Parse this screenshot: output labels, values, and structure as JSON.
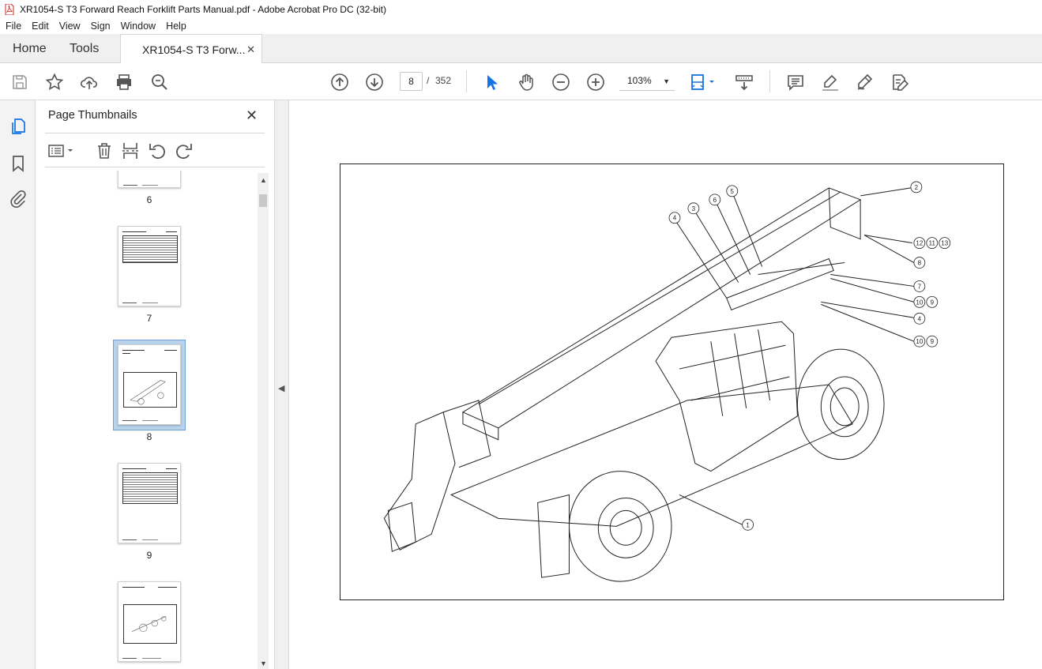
{
  "window": {
    "title": "XR1054-S T3 Forward Reach Forklift Parts Manual.pdf - Adobe Acrobat Pro DC (32-bit)"
  },
  "menu": [
    "File",
    "Edit",
    "View",
    "Sign",
    "Window",
    "Help"
  ],
  "tabs": {
    "home": "Home",
    "tools": "Tools",
    "doc": "XR1054-S T3 Forw...",
    "close": "✕"
  },
  "toolbar": {
    "page_current": "8",
    "page_sep": "/",
    "page_total": "352",
    "zoom": "103%"
  },
  "panel": {
    "title": "Page Thumbnails",
    "close": "✕"
  },
  "thumbnails": [
    {
      "label": "6"
    },
    {
      "label": "7"
    },
    {
      "label": "8",
      "selected": true
    },
    {
      "label": "9"
    },
    {
      "label": ""
    }
  ],
  "drawing": {
    "callouts": [
      "1",
      "2",
      "3",
      "4",
      "5",
      "6",
      "7",
      "8",
      "9",
      "10",
      "11",
      "12",
      "13"
    ]
  },
  "colors": {
    "accent": "#1473e6",
    "selected_thumb_bg": "#b9d3ea",
    "pdf_red": "#d4201e"
  }
}
